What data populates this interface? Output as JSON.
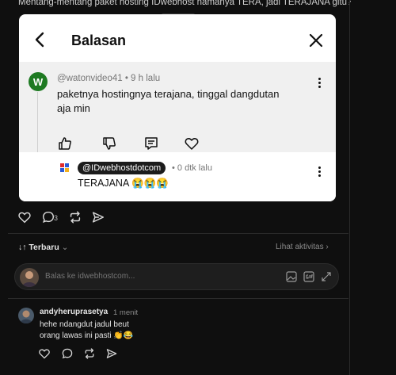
{
  "background_post": {
    "text": "Mentang-mentang paket hosting IDwebhost namanya TERA, jadi TERAJANA gitu? 😭"
  },
  "modal": {
    "title": "Balasan",
    "parent_comment": {
      "avatar_letter": "W",
      "meta": "@watonvideo41 • 9 h lalu",
      "text": "paketnya hostingnya terajana, tinggal dangdutan aja min",
      "actions": [
        "like-icon",
        "dislike-icon",
        "comment-icon",
        "heart-icon"
      ]
    },
    "reply": {
      "handle": "@IDwebhostdotcom",
      "time": "• 0 dtk lalu",
      "text": "TERAJANA 😭😭😭"
    }
  },
  "post_actions": {
    "comment_count": "3"
  },
  "sort": {
    "label": "↓↑ Terbaru",
    "chevron": "⌄"
  },
  "activity_link": "Lihat aktivitas ›",
  "composer": {
    "placeholder": "Balas ke idwebhostcom..."
  },
  "comment": {
    "user": "andyheruprasetya",
    "time": "1 menit",
    "lines": [
      "hehe ndangdut jadul beut",
      "orang lawas ini pasti 👏😂"
    ]
  },
  "colors": {
    "accent_green": "#1e7a22",
    "modal_bg": "#ffffff",
    "page_bg": "#0f0f0f"
  }
}
